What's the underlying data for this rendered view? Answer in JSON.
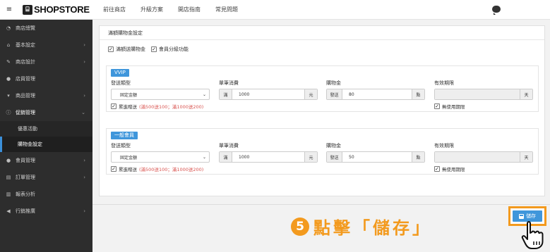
{
  "topbar": {
    "menu_icon": "menu-icon",
    "logo_text": "SHOPSTORE",
    "nav": [
      "前往商店",
      "升級方案",
      "開店指南",
      "常見問題"
    ],
    "chat_icon": "chat-bubble-icon"
  },
  "sidebar": {
    "items": [
      {
        "icon": "dashboard-icon",
        "label": "商店總覽",
        "arrow": ""
      },
      {
        "icon": "bank-icon",
        "label": "基本設定",
        "arrow": "›"
      },
      {
        "icon": "pen-icon",
        "label": "商店設計",
        "arrow": "›"
      },
      {
        "icon": "user-icon",
        "label": "店員管理",
        "arrow": ""
      },
      {
        "icon": "cart-icon",
        "label": "商品管理",
        "arrow": "›"
      },
      {
        "icon": "info-icon",
        "label": "促銷管理",
        "arrow": "⌄"
      },
      {
        "icon": "",
        "label": "優惠活動",
        "arrow": ""
      },
      {
        "icon": "",
        "label": "購物金設定",
        "arrow": ""
      },
      {
        "icon": "users-icon",
        "label": "會員管理",
        "arrow": "›"
      },
      {
        "icon": "clipboard-icon",
        "label": "訂單管理",
        "arrow": "›"
      },
      {
        "icon": "bar-chart-icon",
        "label": "報表分析",
        "arrow": ""
      },
      {
        "icon": "megaphone-icon",
        "label": "行銷推廣",
        "arrow": "›"
      }
    ]
  },
  "panel": {
    "title": "滿額購物金設定",
    "check1": "滿額送購物金",
    "check2": "會員分級功能"
  },
  "tiers": [
    {
      "badge": "VVIP",
      "label_type": "發送類型",
      "select_value": "固定金額",
      "label_spend": "單筆消費",
      "spend_prefix": "滿",
      "spend_value": "1000",
      "spend_suffix": "元",
      "label_credit": "購物金",
      "credit_prefix": "發送",
      "credit_value": "80",
      "credit_suffix": "點",
      "label_expiry": "有效期限",
      "expiry_suffix": "天",
      "cumulative_label": "累進贈送",
      "cumulative_note": "(滿500送100；滿1000送200)",
      "no_expiry_label": "無使用期限"
    },
    {
      "badge": "一般會員",
      "label_type": "發送類型",
      "select_value": "固定金額",
      "label_spend": "單筆消費",
      "spend_prefix": "滿",
      "spend_value": "1000",
      "spend_suffix": "元",
      "label_credit": "購物金",
      "credit_prefix": "發送",
      "credit_value": "50",
      "credit_suffix": "點",
      "label_expiry": "有效期限",
      "expiry_suffix": "天",
      "cumulative_label": "累進贈送",
      "cumulative_note": "(滿500送100；滿1000送200)",
      "no_expiry_label": "無使用期限"
    }
  ],
  "save_button": "儲存",
  "annotation": {
    "number": "5",
    "text": "點擊「儲存」"
  },
  "colors": {
    "accent": "#3f96db",
    "highlight": "#f39a1e",
    "sidebar": "#2d2d2d",
    "note": "#d9534f"
  }
}
